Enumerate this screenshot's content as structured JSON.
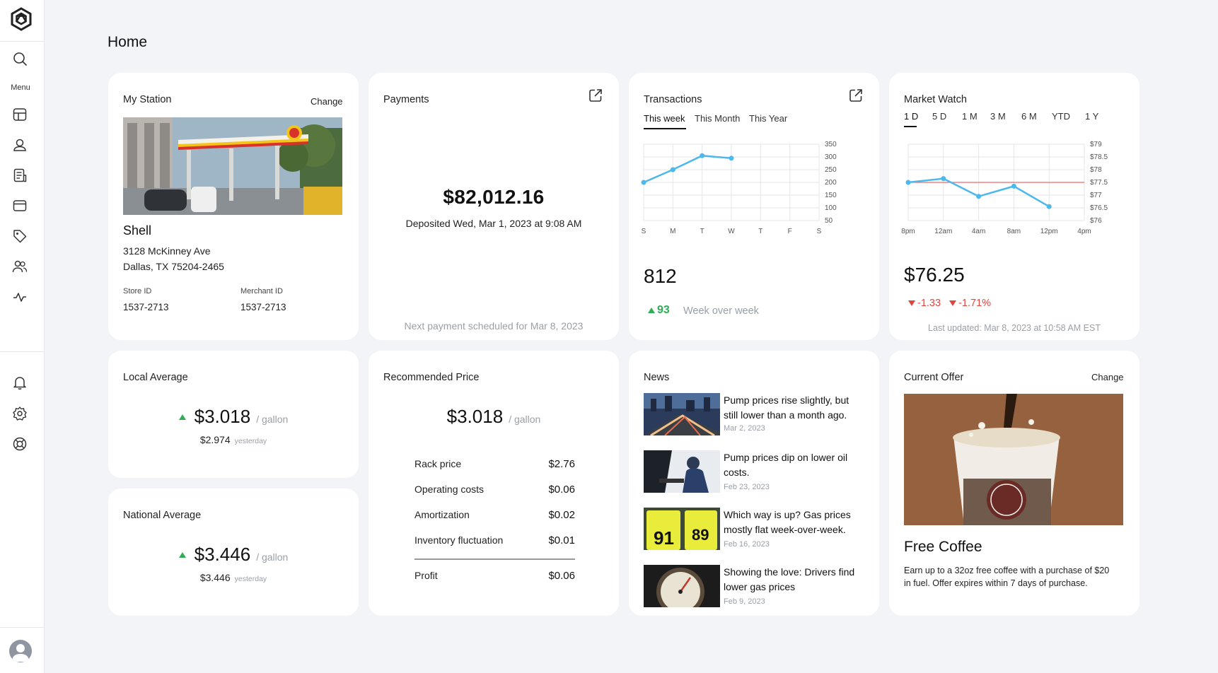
{
  "page": {
    "title": "Home"
  },
  "sidebar": {
    "menu_label": "Menu",
    "icons": [
      "logo-icon",
      "search-icon",
      "dashboard-icon",
      "location-icon",
      "reports-icon",
      "payments-icon",
      "pricing-tag-icon",
      "users-icon",
      "activity-icon",
      "bell-icon",
      "gear-icon",
      "support-icon",
      "user-avatar-icon"
    ]
  },
  "station": {
    "title": "My Station",
    "change_label": "Change",
    "name": "Shell",
    "address_line1": "3128 McKinney Ave",
    "address_line2": "Dallas, TX 75204-2465",
    "store_id_label": "Store ID",
    "store_id": "1537-2713",
    "merchant_id_label": "Merchant ID",
    "merchant_id": "1537-2713"
  },
  "payments": {
    "title": "Payments",
    "amount": "$82,012.16",
    "deposited": "Deposited Wed, Mar 1, 2023 at 9:08 AM",
    "next": "Next payment scheduled for Mar 8, 2023"
  },
  "transactions": {
    "title": "Transactions",
    "tabs": [
      "This week",
      "This Month",
      "This Year"
    ],
    "active_tab": "This week",
    "total": "812",
    "delta": "93",
    "delta_label": "Week over week",
    "chart_data": {
      "type": "line",
      "categories": [
        "S",
        "M",
        "T",
        "W",
        "T",
        "F",
        "S"
      ],
      "values": [
        200,
        250,
        305,
        295
      ],
      "ylim": [
        50,
        350
      ],
      "yticks": [
        350,
        300,
        250,
        200,
        150,
        100,
        50
      ],
      "grid": true,
      "color": "#4db8ec"
    }
  },
  "market": {
    "title": "Market Watch",
    "tabs": [
      "1 D",
      "5 D",
      "1 M",
      "3 M",
      "6 M",
      "YTD",
      "1 Y"
    ],
    "active_tab": "1 D",
    "price": "$76.25",
    "change": "-1.33",
    "change_pct": "-1.71%",
    "updated": "Last updated: Mar 8, 2023 at 10:58 AM EST",
    "chart_data": {
      "type": "line",
      "x": [
        "8pm",
        "12am",
        "4am",
        "8am",
        "12pm",
        "4pm"
      ],
      "values": [
        77.5,
        77.65,
        76.95,
        77.35,
        76.55
      ],
      "reference": 77.5,
      "ylim": [
        76,
        79
      ],
      "yticks": [
        "$79",
        "$78.5",
        "$78",
        "$77.5",
        "$77",
        "$76.5",
        "$76"
      ],
      "grid": true,
      "color": "#4db8ec",
      "reference_color": "#e86b6b"
    }
  },
  "local": {
    "title": "Local Average",
    "price": "$3.018",
    "unit": "/ gallon",
    "yesterday": "$2.974",
    "yesterday_label": "yesterday"
  },
  "national": {
    "title": "National Average",
    "price": "$3.446",
    "unit": "/ gallon",
    "yesterday": "$3.446",
    "yesterday_label": "yesterday"
  },
  "recommended": {
    "title": "Recommended Price",
    "price": "$3.018",
    "unit": "/ gallon",
    "rows": [
      {
        "label": "Rack price",
        "value": "$2.76"
      },
      {
        "label": "Operating costs",
        "value": "$0.06"
      },
      {
        "label": "Amortization",
        "value": "$0.02"
      },
      {
        "label": "Inventory fluctuation",
        "value": "$0.01"
      }
    ],
    "profit_label": "Profit",
    "profit_value": "$0.06"
  },
  "news": {
    "title": "News",
    "items": [
      {
        "title": "Pump prices rise slightly, but still lower than a month ago.",
        "date": "Mar 2, 2023"
      },
      {
        "title": "Pump prices dip on lower oil costs.",
        "date": "Feb 23, 2023"
      },
      {
        "title": "Which way is up? Gas prices mostly flat week-over-week.",
        "date": "Feb 16, 2023"
      },
      {
        "title": "Showing the love: Drivers find lower gas prices",
        "date": "Feb 9, 2023"
      }
    ]
  },
  "offer": {
    "title": "Current Offer",
    "change_label": "Change",
    "name": "Free Coffee",
    "description": "Earn up to a 32oz free coffee with a purchase of $20 in fuel. Offer expires within 7 days of purchase."
  }
}
